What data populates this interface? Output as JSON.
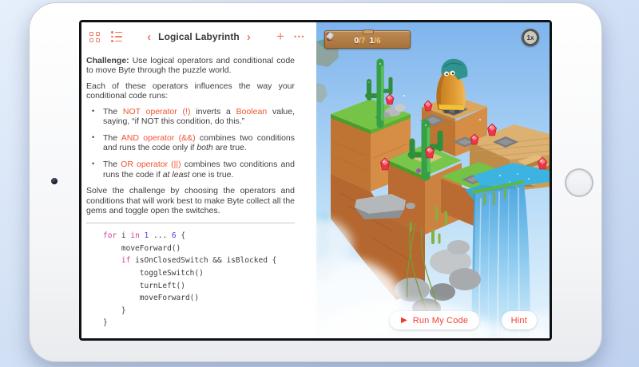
{
  "toolbar": {
    "title": "Logical Labyrinth",
    "prev": "‹",
    "next": "›",
    "add": "+",
    "more": "•••"
  },
  "lesson": {
    "p1_label": "Challenge:",
    "p1_text": " Use logical operators and conditional code to move Byte through the puzzle world.",
    "p2": "Each of these operators influences the way your conditional code runs:",
    "bullets": [
      {
        "s0": "The ",
        "s1": "NOT operator (!)",
        "s2": " inverts a ",
        "s3": "Boolean",
        "s4": " value, saying, “if NOT this condition, do this.”"
      },
      {
        "s0": "The ",
        "s1": "AND operator (&&)",
        "s2": " combines two conditions and runs the code only if ",
        "s3": "both",
        "s4": " are true."
      },
      {
        "s0": "The ",
        "s1": "OR operator (||)",
        "s2": " combines two conditions and runs the code if ",
        "s3": "at least",
        "s4": " one is true."
      }
    ],
    "p3": "Solve the challenge by choosing the operators and conditions that will work best to make Byte collect all the gems and toggle open the switches."
  },
  "code": {
    "l0": {
      "k1": "for",
      "t1": " i ",
      "k2": "in",
      "t2": " ",
      "n1": "1",
      "t3": " ... ",
      "n2": "6",
      "t4": " {"
    },
    "l1": "    moveForward()",
    "l2": {
      "t1": "    ",
      "k1": "if",
      "t2": " isOnClosedSwitch && isBlocked {"
    },
    "l3": "        toggleSwitch()",
    "l4": "        turnLeft()",
    "l5": "        moveForward()",
    "l6": "    }",
    "l7": "}"
  },
  "hud": {
    "gem_current": "0",
    "gem_total": "/7",
    "switch_current": "1",
    "switch_total": "/6",
    "speed": "1x"
  },
  "actions": {
    "run_icon": "▶",
    "run": "Run My Code",
    "hint": "Hint"
  },
  "colors": {
    "accent_coral": "#ee7b67",
    "accent_orange": "#f1532f",
    "keyword_pink": "#ce3d96",
    "number_blue": "#4545d9",
    "run_red": "#f2402f",
    "sign_wood": "#a8713c"
  }
}
